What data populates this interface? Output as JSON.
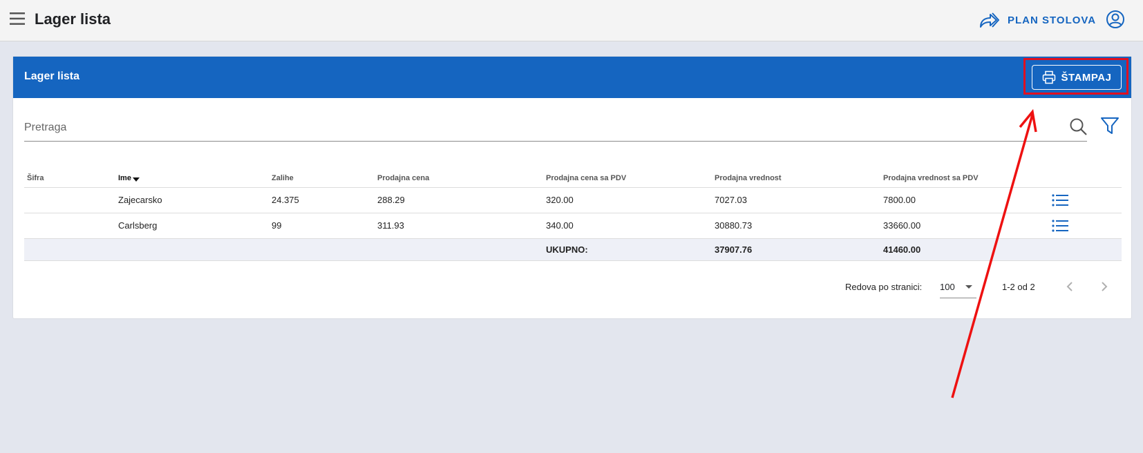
{
  "app": {
    "title": "Lager lista",
    "plan_label": "PLAN STOLOVA"
  },
  "card": {
    "title": "Lager lista",
    "print_label": "ŠTAMPAJ"
  },
  "search": {
    "placeholder": "Pretraga",
    "value": ""
  },
  "table": {
    "columns": [
      "Šifra",
      "Ime",
      "Zalihe",
      "Prodajna cena",
      "Prodajna cena sa PDV",
      "Prodajna vrednost",
      "Prodajna vrednost sa PDV"
    ],
    "sorted_column": "Ime",
    "rows": [
      {
        "sifra": "",
        "ime": "Zajecarsko",
        "zalihe": "24.375",
        "cena": "288.29",
        "cena_pdv": "320.00",
        "vrednost": "7027.03",
        "vrednost_pdv": "7800.00"
      },
      {
        "sifra": "",
        "ime": "Carlsberg",
        "zalihe": "99",
        "cena": "311.93",
        "cena_pdv": "340.00",
        "vrednost": "30880.73",
        "vrednost_pdv": "33660.00"
      }
    ],
    "total": {
      "label": "UKUPNO:",
      "vrednost": "37907.76",
      "vrednost_pdv": "41460.00"
    }
  },
  "pagination": {
    "rows_label": "Redova po stranici:",
    "rows_per_page": "100",
    "range": "1-2 od 2"
  },
  "colors": {
    "primary": "#1565c0",
    "annotation": "#e01020",
    "background": "#e3e6ee"
  },
  "icons": [
    "menu-icon",
    "share-arrow-icon",
    "user-icon",
    "printer-icon",
    "search-icon",
    "filter-icon",
    "list-icon",
    "chevron-left-icon",
    "chevron-right-icon"
  ]
}
